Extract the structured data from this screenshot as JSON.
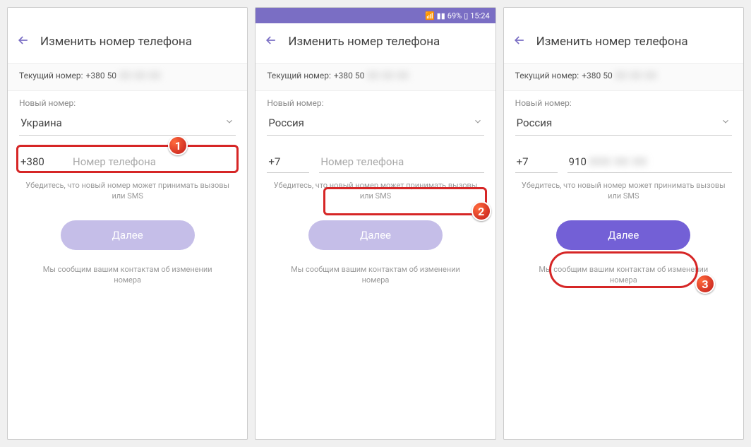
{
  "status_bar": {
    "battery": "69%",
    "time": "15:24"
  },
  "header": {
    "title": "Изменить номер телефона"
  },
  "current": {
    "label": "Текущий номер:",
    "value": "+380 50",
    "masked": "XX XX XX"
  },
  "new_label": "Новый номер:",
  "phone_placeholder": "Номер телефона",
  "hint": "Убедитесь, что новый номер может принимать вызовы или SMS",
  "button": "Далее",
  "note": "Мы сообщим вашим контактам об изменении номера",
  "badges": {
    "b1": "1",
    "b2": "2",
    "b3": "3"
  },
  "panels": [
    {
      "country": "Украина",
      "code": "+380",
      "number": "",
      "number_filled": "",
      "btn_enabled": false
    },
    {
      "country": "Россия",
      "code": "+7",
      "number": "",
      "number_filled": "",
      "btn_enabled": false
    },
    {
      "country": "Россия",
      "code": "+7",
      "number": "910",
      "number_filled": "XXX XX XX",
      "btn_enabled": true
    }
  ]
}
